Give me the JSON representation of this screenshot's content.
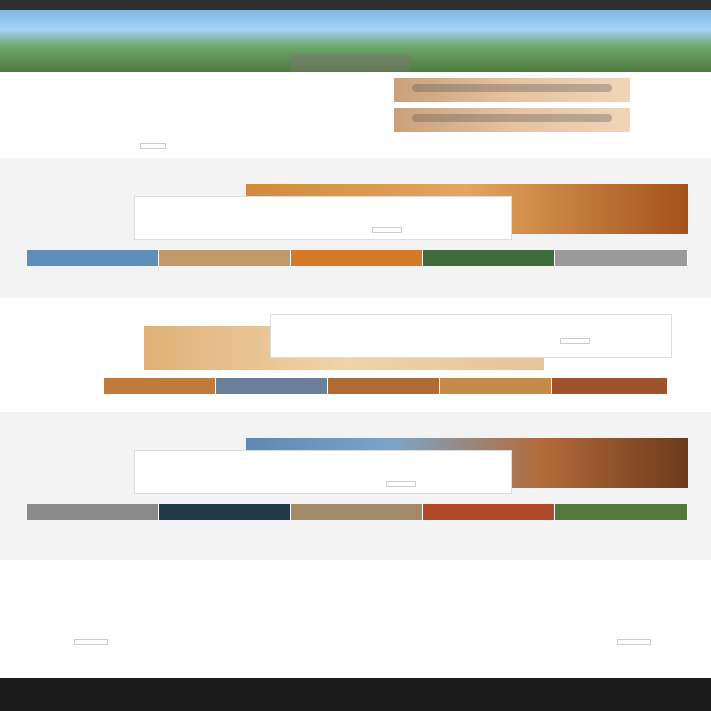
{
  "topbar": {
    "brand": "",
    "nav": [
      "",
      "",
      "",
      "",
      ""
    ]
  },
  "hero": {
    "title": "",
    "subtitle": ""
  },
  "intro": {
    "title_en": "",
    "line1": "",
    "line2": "",
    "english": "",
    "button": ""
  },
  "sections": [
    {
      "heading": "",
      "panel_title": "",
      "panel_sub": "",
      "more": ""
    },
    {
      "heading": "",
      "panel_title": "",
      "panel_sub": "",
      "more": ""
    },
    {
      "heading": "",
      "panel_title": "",
      "panel_sub": "",
      "more": ""
    }
  ],
  "message": {
    "lines": [
      "",
      "",
      "",
      ""
    ]
  },
  "contacts": [
    {
      "label": "",
      "button": ""
    },
    {
      "label": "",
      "button": ""
    }
  ],
  "footer": {
    "left_lines": [
      "",
      ""
    ],
    "right_lines": [
      "",
      ""
    ],
    "bottom": ""
  }
}
